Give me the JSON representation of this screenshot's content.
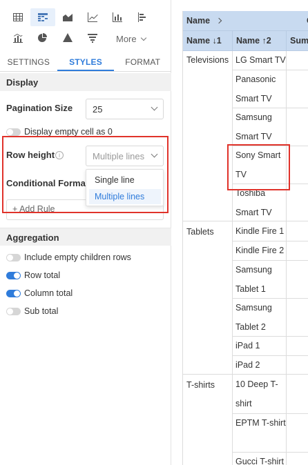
{
  "toolbar": {
    "icons_row1": [
      "table-icon",
      "pivot-table-icon",
      "area-chart-icon",
      "line-chart-icon",
      "bar-chart-icon",
      "horizontal-bar-icon"
    ],
    "icons_row2": [
      "combo-chart-icon",
      "pie-chart-icon",
      "pyramid-icon",
      "funnel-icon"
    ],
    "more_label": "More"
  },
  "tabs": [
    "SETTINGS",
    "STYLES",
    "FORMAT"
  ],
  "display": {
    "section_title": "Display",
    "pagination_label": "Pagination Size",
    "pagination_value": "25",
    "empty_cell_label": "Display empty cell as 0",
    "row_height_label": "Row height",
    "row_height_placeholder": "Multiple lines",
    "row_height_options": [
      "Single line",
      "Multiple lines"
    ],
    "row_height_selected": "Multiple lines",
    "conditional_label": "Conditional Formatting",
    "add_rule_label": "+ Add Rule"
  },
  "aggregation": {
    "section_title": "Aggregation",
    "toggles": [
      {
        "label": "Include empty children rows",
        "on": false
      },
      {
        "label": "Row total",
        "on": true
      },
      {
        "label": "Column total",
        "on": true
      },
      {
        "label": "Sub total",
        "on": false
      }
    ]
  },
  "table": {
    "header_row1": "Name",
    "header_row1_more": "C",
    "columns": [
      "Name ↓1",
      "Name ↑2",
      "Sum"
    ],
    "groups": [
      {
        "name": "Televisions",
        "items": [
          "LG Smart TV",
          "Panasonic Smart TV",
          "Samsung Smart TV",
          "Sony Smart TV",
          "Toshiba Smart TV"
        ]
      },
      {
        "name": "Tablets",
        "items": [
          "Kindle Fire 1",
          "Kindle Fire 2",
          "Samsung Tablet 1",
          "Samsung Tablet 2",
          "iPad 1",
          "iPad 2"
        ]
      },
      {
        "name": "T-shirts",
        "items": [
          "10 Deep T-shirt",
          "EPTM T-shirt",
          "Gucci T-shirt"
        ]
      }
    ]
  },
  "colors": {
    "accent": "#2f7cdb",
    "header": "#c8daf0",
    "highlight": "#e0322a"
  }
}
